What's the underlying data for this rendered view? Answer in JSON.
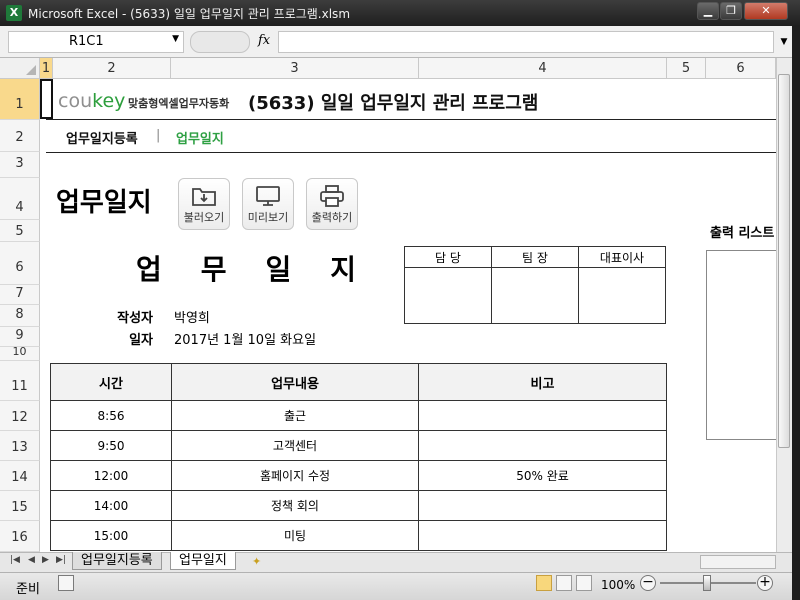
{
  "window": {
    "title": "Microsoft Excel - (5633) 일일 업무일지 관리 프로그램.xlsm",
    "app_icon": "X",
    "minimize": "▁",
    "restore": "❐",
    "close": "✕"
  },
  "formula_bar": {
    "name_box": "R1C1",
    "fx": "fx",
    "value": ""
  },
  "columns": [
    "1",
    "2",
    "3",
    "4",
    "5",
    "6"
  ],
  "rows": [
    "1",
    "2",
    "3",
    "4",
    "5",
    "6",
    "7",
    "8",
    "9",
    "10",
    "11",
    "12",
    "13",
    "14",
    "15",
    "16"
  ],
  "header": {
    "logo_a": "cou",
    "logo_b": "key",
    "logo_tagline": "맞춤형엑셀업무자동화",
    "app_title": "(5633) 일일 업무일지 관리 프로그램"
  },
  "nav": {
    "item1": "업무일지등록",
    "separator": "|",
    "item2": "업무일지"
  },
  "page": {
    "title": "업무일지",
    "buttons": {
      "load": "불러오기",
      "preview": "미리보기",
      "print": "출력하기"
    },
    "doc_title": [
      "업",
      "무",
      "일",
      "지"
    ]
  },
  "approval": {
    "headers": [
      "담 당",
      "팀 장",
      "대표이사"
    ]
  },
  "meta": {
    "author_label": "작성자",
    "author": "박영희",
    "date_label": "일자",
    "date": "2017년 1월 10일 화요일"
  },
  "log_table": {
    "headers": [
      "시간",
      "업무내용",
      "비고"
    ],
    "rows": [
      [
        "8:56",
        "출근",
        ""
      ],
      [
        "9:50",
        "고객센터",
        ""
      ],
      [
        "12:00",
        "홈페이지 수정",
        "50% 완료"
      ],
      [
        "14:00",
        "정책 회의",
        ""
      ],
      [
        "15:00",
        "미팅",
        ""
      ]
    ]
  },
  "print_panel": {
    "label": "출력 리스트"
  },
  "sheet_tabs": {
    "tab1": "업무일지등록",
    "tab2": "업무일지"
  },
  "status": {
    "ready": "준비",
    "zoom": "100%"
  }
}
